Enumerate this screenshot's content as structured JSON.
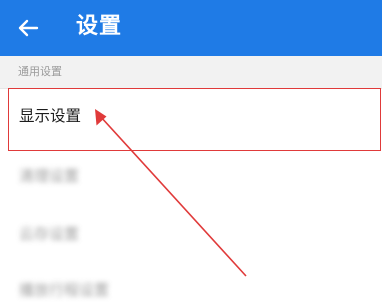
{
  "colors": {
    "app_bar": "#1f7be6",
    "highlight": "#e03a3a",
    "section_bg": "#f2f2f2"
  },
  "header": {
    "title": "设置",
    "back_icon": "arrow-left-icon"
  },
  "section": {
    "label": "通用设置"
  },
  "settings": {
    "items": [
      {
        "label": "显示设置",
        "highlighted": true
      },
      {
        "label": "清理设置",
        "blurred": true
      },
      {
        "label": "云存设置",
        "blurred": true
      },
      {
        "label": "播放行程设置",
        "blurred": true
      }
    ]
  },
  "annotation": {
    "type": "red-arrow-pointing-to-item",
    "target_item": "显示设置"
  }
}
